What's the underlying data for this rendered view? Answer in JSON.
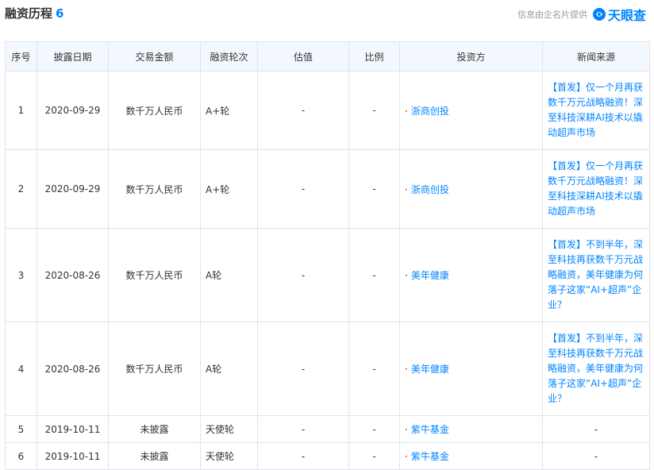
{
  "header": {
    "title": "融资历程",
    "count": "6",
    "provider_text": "信息由企名片提供",
    "logo_text": "天眼查",
    "brand_color": "#0084ff"
  },
  "table": {
    "columns": [
      "序号",
      "披露日期",
      "交易金额",
      "融资轮次",
      "估值",
      "比例",
      "投资方",
      "新闻来源"
    ],
    "rows": [
      {
        "no": "1",
        "date": "2020-09-29",
        "amount": "数千万人民币",
        "round": "A+轮",
        "valuation": "-",
        "ratio": "-",
        "investor": "浙商创投",
        "news": "【首发】仅一个月再获数千万元战略融资！深至科技深耕AI技术以撬动超声市场"
      },
      {
        "no": "2",
        "date": "2020-09-29",
        "amount": "数千万人民币",
        "round": "A+轮",
        "valuation": "-",
        "ratio": "-",
        "investor": "浙商创投",
        "news": "【首发】仅一个月再获数千万元战略融资！深至科技深耕AI技术以撬动超声市场"
      },
      {
        "no": "3",
        "date": "2020-08-26",
        "amount": "数千万人民币",
        "round": "A轮",
        "valuation": "-",
        "ratio": "-",
        "investor": "美年健康",
        "news": "【首发】不到半年，深至科技再获数千万元战略融资，美年健康为何落子这家“AI+超声”企业？"
      },
      {
        "no": "4",
        "date": "2020-08-26",
        "amount": "数千万人民币",
        "round": "A轮",
        "valuation": "-",
        "ratio": "-",
        "investor": "美年健康",
        "news": "【首发】不到半年，深至科技再获数千万元战略融资，美年健康为何落子这家“AI+超声”企业？"
      },
      {
        "no": "5",
        "date": "2019-10-11",
        "amount": "未披露",
        "round": "天使轮",
        "valuation": "-",
        "ratio": "-",
        "investor": "紫牛基金",
        "news": "-"
      },
      {
        "no": "6",
        "date": "2019-10-11",
        "amount": "未披露",
        "round": "天使轮",
        "valuation": "-",
        "ratio": "-",
        "investor": "紫牛基金",
        "news": "-"
      }
    ]
  },
  "icons": {
    "logo": "tianyancha-logo-icon"
  }
}
